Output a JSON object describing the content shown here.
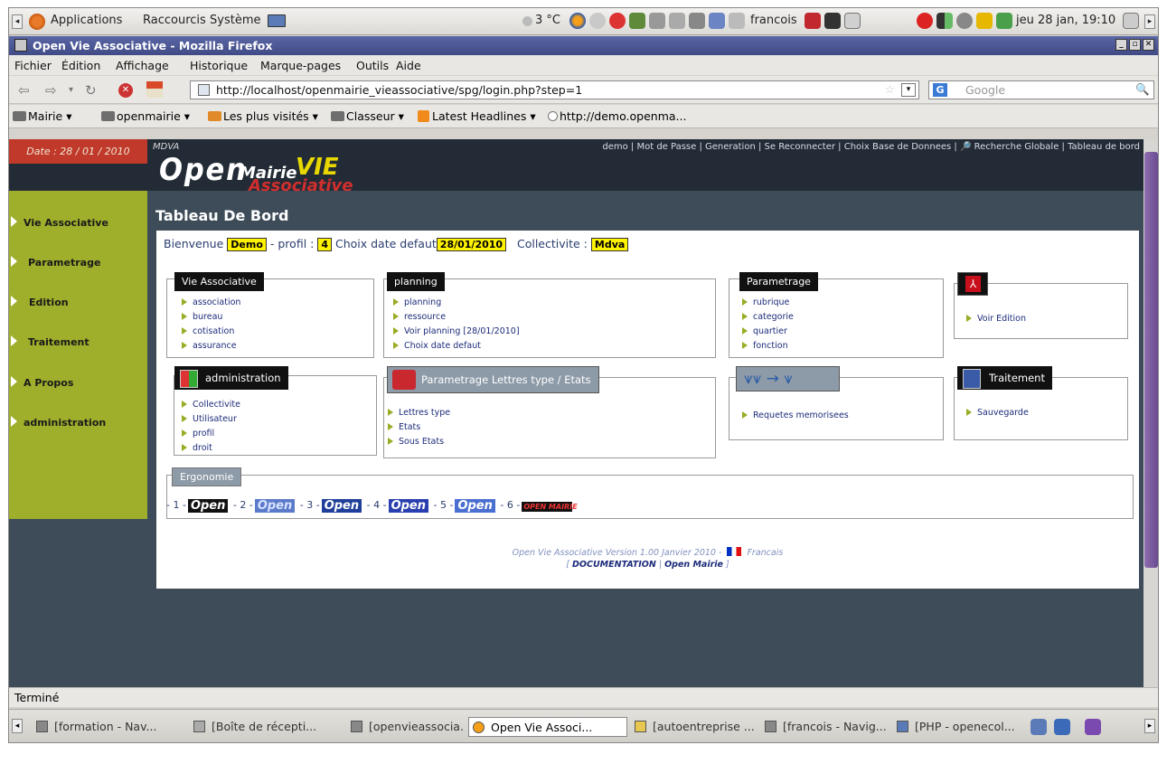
{
  "panel": {
    "menus": [
      "Applications",
      "Raccourcis",
      "Système"
    ],
    "weather": "3 °C",
    "user": "francois",
    "clock": "jeu 28 jan, 19:10"
  },
  "window": {
    "title": "Open Vie Associative - Mozilla Firefox"
  },
  "menubar": [
    "Fichier",
    "Édition",
    "Affichage",
    "Historique",
    "Marque-pages",
    "Outils",
    "Aide"
  ],
  "navbar": {
    "url": "http://localhost/openmairie_vieassociative/spg/login.php?step=1",
    "search_placeholder": "Google"
  },
  "bookmarks": [
    "Mairie ▾",
    "openmairie ▾",
    "Les plus visités ▾",
    "Classeur ▾",
    "Latest Headlines ▾",
    "http://demo.openma..."
  ],
  "app": {
    "date_label": "Date : 28 / 01 / 2010",
    "org_short": "MDVA",
    "top_links": "demo | Mot de Passe | Generation | Se Reconnecter | Choix Base de Donnees | 🔎 Recherche Globale | Tableau de bord",
    "logo": {
      "open": "Open",
      "mairie": "Mairie",
      "vie": "VIE",
      "asso": "Associative"
    },
    "sidebar": [
      "Vie Associative",
      "Parametrage",
      "Edition",
      "Traitement",
      "A Propos",
      "administration"
    ],
    "page_title": "Tableau De Bord",
    "welcome": {
      "bienvenue": "Bienvenue",
      "user": "Demo",
      "profil_label": "- profil :",
      "profil": "4",
      "choix_label": "Choix date defaut",
      "date": "28/01/2010",
      "collectivite_label": "Collectivite :",
      "collectivite": "Mdva"
    },
    "boxes": {
      "vie": {
        "title": "Vie Associative",
        "items": [
          "association",
          "bureau",
          "cotisation",
          "assurance"
        ]
      },
      "planning": {
        "title": "planning",
        "items": [
          "planning",
          "ressource",
          "Voir planning [28/01/2010]",
          "Choix date defaut"
        ]
      },
      "param": {
        "title": "Parametrage",
        "items": [
          "rubrique",
          "categorie",
          "quartier",
          "fonction"
        ]
      },
      "edition": {
        "items": [
          "Voir Edition"
        ]
      },
      "admin": {
        "title": "administration",
        "items": [
          "Collectivite",
          "Utilisateur",
          "profil",
          "droit"
        ]
      },
      "lettres": {
        "title": "Parametrage Lettres type / Etats",
        "items": [
          "Lettres type",
          "Etats",
          "Sous Etats"
        ]
      },
      "requetes": {
        "items": [
          "Requetes memorisees"
        ]
      },
      "traitement": {
        "title": "Traitement",
        "items": [
          "Sauvegarde"
        ]
      }
    },
    "ergonomie": {
      "title": "Ergonomie",
      "options": [
        {
          "num": "- 1 -",
          "label": "Open"
        },
        {
          "num": "- 2 -",
          "label": "Open"
        },
        {
          "num": "- 3 -",
          "label": "Open"
        },
        {
          "num": "- 4 -",
          "label": "Open"
        },
        {
          "num": "- 5 -",
          "label": "Open"
        },
        {
          "num": "- 6 -",
          "label": "OPEN MAIRIE"
        }
      ]
    },
    "footer": {
      "version": "Open Vie Associative  Version 1.00 Janvier 2010 -",
      "lang": "Francais",
      "doc": "DOCUMENTATION",
      "om": "Open Mairie"
    }
  },
  "status": "Terminé",
  "taskbar": [
    "[formation - Nav...",
    "[Boîte de récepti...",
    "[openvieassocia...",
    "Open Vie Associ...",
    "[autoentreprise ...",
    "[francois - Navig...",
    "[PHP - openecol..."
  ]
}
